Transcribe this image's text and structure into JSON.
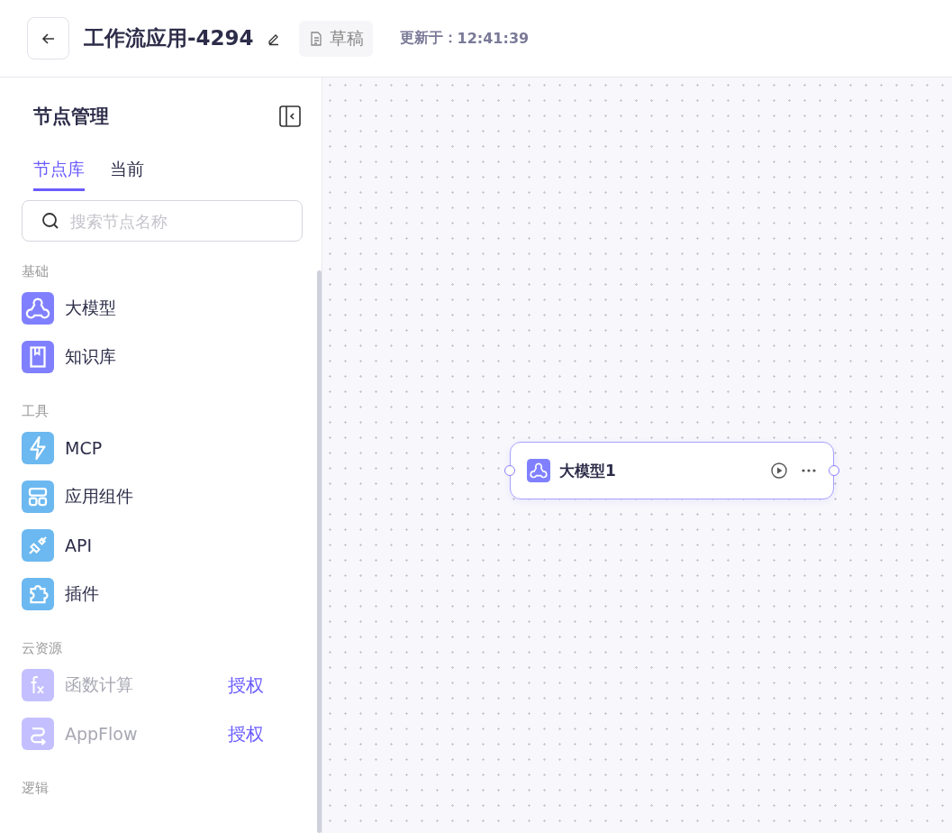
{
  "header": {
    "title": "工作流应用-4294",
    "status": "草稿",
    "updated_label": "更新于：",
    "updated_time": "12:41:39"
  },
  "sidebar": {
    "title": "节点管理",
    "tabs": [
      {
        "label": "节点库",
        "selected": true
      },
      {
        "label": "当前",
        "selected": false
      }
    ],
    "search": {
      "placeholder": "搜索节点名称"
    },
    "groups": [
      {
        "title": "基础",
        "items": [
          {
            "label": "大模型",
            "color": "#8080ff",
            "disabled": false
          },
          {
            "label": "知识库",
            "color": "#8080ff",
            "disabled": false
          }
        ]
      },
      {
        "title": "工具",
        "items": [
          {
            "label": "MCP",
            "color": "#6cb8f0",
            "disabled": false
          },
          {
            "label": "应用组件",
            "color": "#6cb8f0",
            "disabled": false
          },
          {
            "label": "API",
            "color": "#6cb8f0",
            "disabled": false
          },
          {
            "label": "插件",
            "color": "#6cb8f0",
            "disabled": false
          }
        ]
      },
      {
        "title": "云资源",
        "items": [
          {
            "label": "函数计算",
            "color": "#c4c0ff",
            "disabled": true,
            "action": "授权"
          },
          {
            "label": "AppFlow",
            "color": "#c4c0ff",
            "disabled": true,
            "action": "授权"
          }
        ]
      },
      {
        "title": "逻辑"
      }
    ]
  },
  "canvas": {
    "nodes": [
      {
        "label": "大模型1"
      }
    ]
  }
}
